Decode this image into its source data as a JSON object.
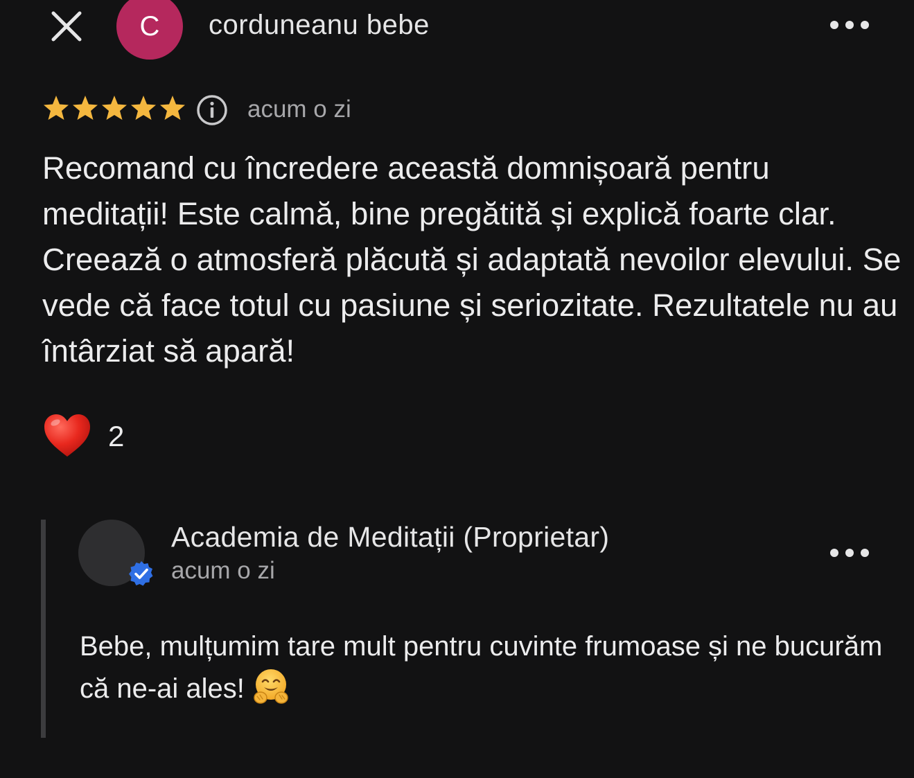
{
  "header": {
    "close_icon": "close-icon",
    "reviewer_initial": "C",
    "reviewer_name": "corduneanu bebe",
    "avatar_color": "#b5285d",
    "more_icon": "more-horizontal-icon"
  },
  "rating": {
    "stars": 5,
    "max_stars": 5,
    "star_color": "#f4b73f",
    "info_icon": "info-icon",
    "time": "acum o zi"
  },
  "review": {
    "text": "Recomand cu încredere această domnișoară pentru meditații! Este calmă, bine pregătită și explică foarte clar. Creează o atmosferă plăcută și adaptată nevoilor elevului. Se vede că face totul cu pasiune și seriozitate. Rezultatele nu au întârziat să apară!"
  },
  "reaction": {
    "icon": "heart-icon",
    "count": "2"
  },
  "owner_reply": {
    "name": "Academia de Meditații (Proprietar)",
    "time": "acum o zi",
    "verified_icon": "verified-badge-icon",
    "text": "Bebe, mulțumim tare mult pentru cuvinte frumoase și ne bucurăm că ne-ai ales!",
    "emoji": "hugging-face-emoji"
  }
}
